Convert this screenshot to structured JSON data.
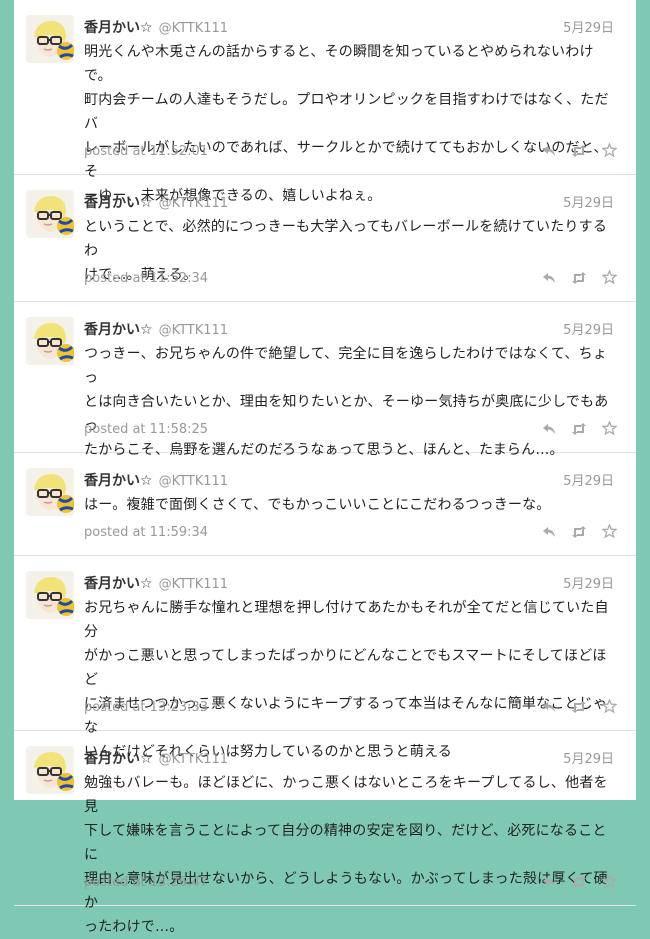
{
  "tweets": [
    {
      "name": "香月かい☆",
      "handle": "@KTTK111",
      "date": "5月29日",
      "lines": [
        "明光くんや木兎さんの話からすると、その瞬間を知っているとやめられないわけで。",
        "町内会チームの人達もそうだし。プロやオリンピックを目指すわけではなく、ただバ",
        "レーボールがしたいのであれば、サークルとかで続けててもおかしくないのだと、そ",
        "ーゆー、未来が想像できるの、嬉しいよねぇ。"
      ],
      "posted": "posted at 11:52:01"
    },
    {
      "name": "香月かい☆",
      "handle": "@KTTK111",
      "date": "5月29日",
      "lines": [
        "ということで、必然的につっきーも大学入ってもバレーボールを続けていたりするわ",
        "けで…。萌える。"
      ],
      "posted": "posted at 11:52:34"
    },
    {
      "name": "香月かい☆",
      "handle": "@KTTK111",
      "date": "5月29日",
      "lines": [
        "つっきー、お兄ちゃんの件で絶望して、完全に目を逸らしたわけではなくて、ちょっ",
        "とは向き合いたいとか、理由を知りたいとか、そーゆー気持ちが奥底に少しでもあっ",
        "たからこそ、烏野を選んだのだろうなぁって思うと、ほんと、たまらん…。"
      ],
      "posted": "posted at 11:58:25"
    },
    {
      "name": "香月かい☆",
      "handle": "@KTTK111",
      "date": "5月29日",
      "lines": [
        "はー。複雑で面倒くさくて、でもかっこいいことにこだわるつっきーな。"
      ],
      "posted": "posted at 11:59:34"
    },
    {
      "name": "香月かい☆",
      "handle": "@KTTK111",
      "date": "5月29日",
      "lines": [
        "お兄ちゃんに勝手な憧れと理想を押し付けてあたかもそれが全てだと信じていた自分",
        "がかっこ悪いと思ってしまったばっかりにどんなことでもスマートにそしてほどほど",
        "に済ませつつかっこ悪くないようにキープするって本当はそんなに簡単なことじゃな",
        "いんだけどそれくらいは努力しているのかと思うと萌える"
      ],
      "posted": "posted at 13:23:33"
    },
    {
      "name": "香月かい☆",
      "handle": "@KTTK111",
      "date": "5月29日",
      "lines": [
        "勉強もバレーも。ほどほどに、かっこ悪くはないところをキープしてるし、他者を見",
        "下して嫌味を言うことによって自分の精神の安定を図り、だけど、必死になることに",
        "理由と意味が見出せないから、どうしようもない。かぶってしまった殻は厚くて硬か",
        "ったわけで…。"
      ],
      "posted": "posted at 13:26:47"
    }
  ],
  "icons": {
    "reply": "reply-icon",
    "retweet": "retweet-icon",
    "favorite": "star-icon"
  },
  "colors": {
    "background": "#7ec8b4",
    "panel": "#ffffff",
    "meta": "#999999"
  }
}
